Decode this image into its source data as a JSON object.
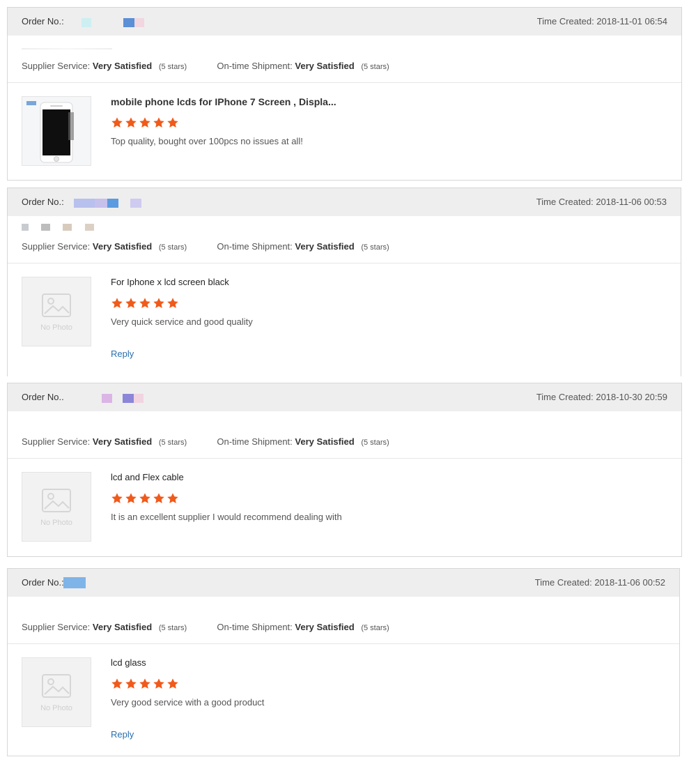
{
  "colors": {
    "star": "#f05a1a",
    "link": "#2a6fb0",
    "header_bg": "#eeeeee"
  },
  "labels": {
    "time_created": "Time Created:",
    "supplier_service": "Supplier Service:",
    "ontime_shipment": "On-time Shipment:",
    "no_photo": "No Photo",
    "reply": "Reply"
  },
  "reviews": [
    {
      "order_label": "Order No.: ",
      "time": "2018-11-01 06:54",
      "supplier_value": "Very Satisfied",
      "supplier_stars": "(5 stars)",
      "shipment_value": "Very Satisfied",
      "shipment_stars": "(5 stars)",
      "product": "mobile phone lcds for IPhone 7 Screen , Displa...",
      "rating": 5,
      "comment": "Top quality, bought over 100pcs no issues at all!",
      "has_photo": true
    },
    {
      "order_label": "Order No.: ",
      "time": "2018-11-06 00:53",
      "supplier_value": "Very Satisfied",
      "supplier_stars": "(5 stars)",
      "shipment_value": "Very Satisfied",
      "shipment_stars": "(5 stars)",
      "product": "For Iphone x lcd screen black",
      "rating": 5,
      "comment": "Very quick service and good quality",
      "has_photo": false
    },
    {
      "order_label": "Order No..",
      "time": "2018-10-30 20:59",
      "supplier_value": "Very Satisfied",
      "supplier_stars": "(5 stars)",
      "shipment_value": "Very Satisfied",
      "shipment_stars": "(5 stars)",
      "product": "lcd and Flex cable",
      "rating": 5,
      "comment": "It is an excellent supplier I would recommend dealing with",
      "has_photo": false
    },
    {
      "order_label": "Order No.:",
      "time": "2018-11-06 00:52",
      "supplier_value": "Very Satisfied",
      "supplier_stars": "(5 stars)",
      "shipment_value": "Very Satisfied",
      "shipment_stars": "(5 stars)",
      "product": "lcd glass",
      "rating": 5,
      "comment": "Very good service with a good product",
      "has_photo": false
    }
  ]
}
